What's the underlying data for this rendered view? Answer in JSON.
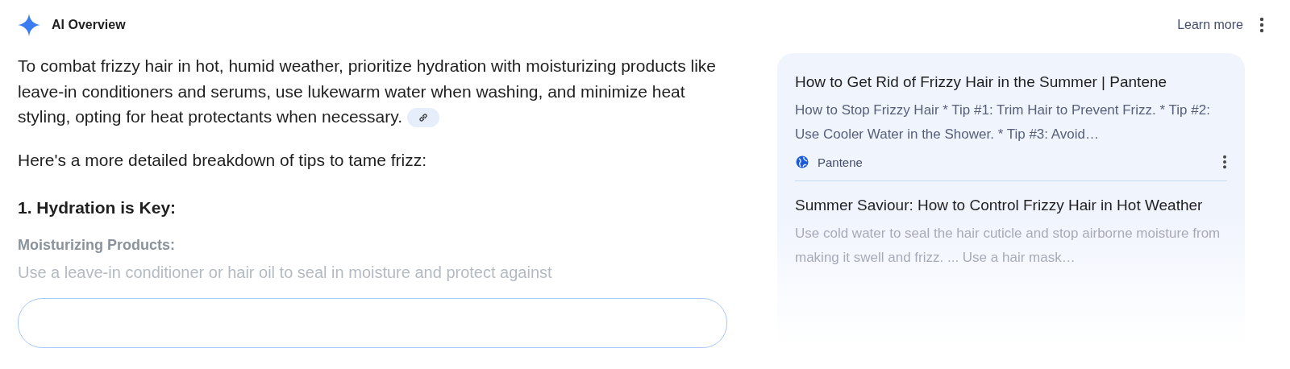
{
  "header": {
    "title": "AI Overview",
    "learn_more": "Learn more"
  },
  "answer": {
    "summary": "To combat frizzy hair in hot, humid weather, prioritize hydration with moisturizing products like leave-in conditioners and serums, use lukewarm water when washing, and minimize heat styling, opting for heat protectants when necessary.",
    "intro": "Here's a more detailed breakdown of tips to tame frizz:",
    "section_heading": "1. Hydration is Key:",
    "subheading": "Moisturizing Products:",
    "faded_text": "Use a leave-in conditioner or hair oil to seal in moisture and protect against"
  },
  "sources": [
    {
      "title": "How to Get Rid of Frizzy Hair in the Summer | Pantene",
      "snippet": "How to Stop Frizzy Hair * Tip #1: Trim Hair to Prevent Frizz. * Tip #2: Use Cooler Water in the Shower. * Tip #3: Avoid…",
      "site": "Pantene"
    },
    {
      "title": "Summer Saviour: How to Control Frizzy Hair in Hot Weather",
      "snippet": "Use cold water to seal the hair cuticle and stop airborne moisture from making it swell and frizz. ... Use a hair mask…"
    }
  ]
}
